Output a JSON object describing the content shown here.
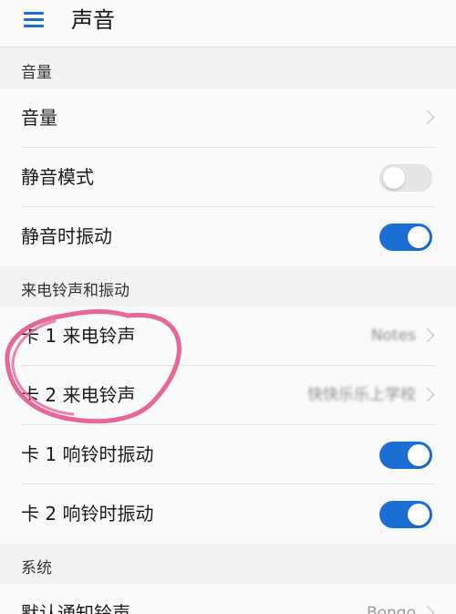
{
  "appbar": {
    "title": "声音",
    "menu_icon": "hamburger-menu-icon"
  },
  "sections": {
    "volume": {
      "header": "音量",
      "rows": {
        "volume": {
          "label": "音量"
        },
        "silent_mode": {
          "label": "静音模式",
          "toggle": "off"
        },
        "vibrate_silent": {
          "label": "静音时振动",
          "toggle": "on"
        }
      }
    },
    "ringtone": {
      "header": "来电铃声和振动",
      "rows": {
        "sim1_ringtone": {
          "label": "卡 1 来电铃声",
          "value": "Notes"
        },
        "sim2_ringtone": {
          "label": "卡 2 来电铃声",
          "value": "快快乐乐上学校"
        },
        "sim1_vibrate": {
          "label": "卡 1 响铃时振动",
          "toggle": "on"
        },
        "sim2_vibrate": {
          "label": "卡 2 响铃时振动",
          "toggle": "on"
        }
      }
    },
    "system": {
      "header": "系统",
      "rows": {
        "default_notification": {
          "label": "默认通知铃声",
          "value": "Bongo"
        }
      }
    }
  },
  "colors": {
    "accent": "#1a6fd6",
    "annotation": "#e8679a",
    "background": "#f2f2f2",
    "row": "#fafafa"
  }
}
